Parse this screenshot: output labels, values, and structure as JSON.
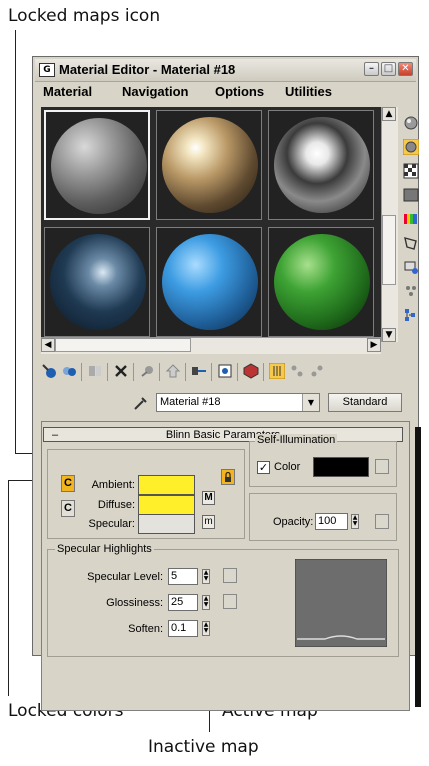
{
  "callouts": {
    "locked_maps_icon": "Locked maps icon",
    "locked_colors": "Locked colors",
    "active_map": "Active map",
    "inactive_map": "Inactive map"
  },
  "window": {
    "title": "Material Editor - Material #18",
    "app_icon_glyph": "G",
    "controls": [
      "–",
      "□",
      "✕"
    ]
  },
  "menu": [
    "Material",
    "Navigation",
    "Options",
    "Utilities"
  ],
  "sample_slots": [
    {
      "name": "stone-gray"
    },
    {
      "name": "metal-gold"
    },
    {
      "name": "chrome"
    },
    {
      "name": "dark-blue-ice"
    },
    {
      "name": "blue"
    },
    {
      "name": "green"
    }
  ],
  "material_name": "Material #18",
  "material_type": "Standard",
  "rollout_toggle": "–",
  "rollout_title": "Blinn Basic Parameters",
  "colors": {
    "ambient_label": "Ambient:",
    "diffuse_label": "Diffuse:",
    "specular_label": "Specular:",
    "ambient": "#ffef2a",
    "diffuse": "#ffef2a",
    "specular": "#e4e2dc",
    "lock_glyph": "C",
    "diffuse_map_button": "M",
    "specular_map_button": "m"
  },
  "self_illumination": {
    "title": "Self-Illumination",
    "color_label": "Color",
    "checked": true,
    "color": "#000000"
  },
  "opacity": {
    "label": "Opacity:",
    "value": "100"
  },
  "specular_highlights": {
    "title": "Specular Highlights",
    "level_label": "Specular Level:",
    "level_value": "5",
    "gloss_label": "Glossiness:",
    "gloss_value": "25",
    "soften_label": "Soften:",
    "soften_value": "0.1"
  },
  "icons": [
    "get-material-icon",
    "put-to-scene-icon",
    "assign-material-icon",
    "reset-icon",
    "make-copy-icon",
    "put-to-library-icon",
    "material-effects-icon",
    "show-map-icon",
    "show-end-result-icon",
    "go-to-parent-icon",
    "go-forward-icon",
    "sample-type-icon",
    "backlight-icon",
    "background-icon",
    "uv-tiling-icon",
    "video-check-icon",
    "make-preview-icon",
    "options-icon",
    "select-by-material-icon",
    "material-navigator-icon",
    "pick-material-icon",
    "lock-icon"
  ]
}
